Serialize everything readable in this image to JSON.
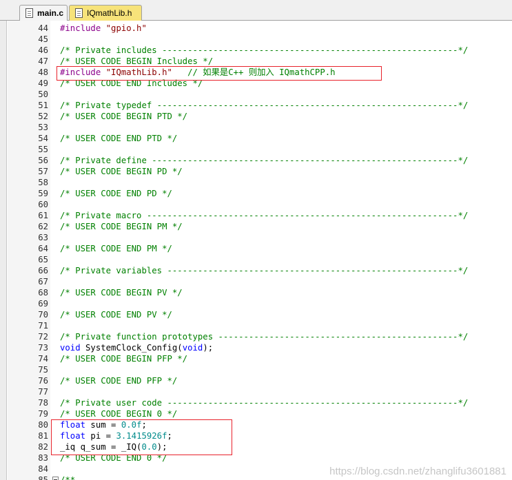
{
  "tabs": [
    {
      "label": "main.c",
      "active": false
    },
    {
      "label": "IQmathLib.h",
      "active": true
    }
  ],
  "lines": [
    {
      "n": "44",
      "segs": [
        {
          "t": "#include ",
          "c": "pp"
        },
        {
          "t": "\"gpio.h\"",
          "c": "str"
        }
      ]
    },
    {
      "n": "45",
      "segs": []
    },
    {
      "n": "46",
      "segs": [
        {
          "t": "/* Private includes ----------------------------------------------------------*/",
          "c": "cmt"
        }
      ]
    },
    {
      "n": "47",
      "segs": [
        {
          "t": "/* USER CODE BEGIN Includes */",
          "c": "cmt"
        }
      ]
    },
    {
      "n": "48",
      "segs": [
        {
          "t": "#include ",
          "c": "pp"
        },
        {
          "t": "\"IQmathLib.h\"",
          "c": "str"
        },
        {
          "t": "   // 如果是C++ 则加入 IQmathCPP.h",
          "c": "cmt"
        }
      ]
    },
    {
      "n": "49",
      "segs": [
        {
          "t": "/* USER CODE END Includes */",
          "c": "cmt"
        }
      ]
    },
    {
      "n": "50",
      "segs": []
    },
    {
      "n": "51",
      "segs": [
        {
          "t": "/* Private typedef -----------------------------------------------------------*/",
          "c": "cmt"
        }
      ]
    },
    {
      "n": "52",
      "segs": [
        {
          "t": "/* USER CODE BEGIN PTD */",
          "c": "cmt"
        }
      ]
    },
    {
      "n": "53",
      "segs": []
    },
    {
      "n": "54",
      "segs": [
        {
          "t": "/* USER CODE END PTD */",
          "c": "cmt"
        }
      ]
    },
    {
      "n": "55",
      "segs": []
    },
    {
      "n": "56",
      "segs": [
        {
          "t": "/* Private define ------------------------------------------------------------*/",
          "c": "cmt"
        }
      ]
    },
    {
      "n": "57",
      "segs": [
        {
          "t": "/* USER CODE BEGIN PD */",
          "c": "cmt"
        }
      ]
    },
    {
      "n": "58",
      "segs": []
    },
    {
      "n": "59",
      "segs": [
        {
          "t": "/* USER CODE END PD */",
          "c": "cmt"
        }
      ]
    },
    {
      "n": "60",
      "segs": []
    },
    {
      "n": "61",
      "segs": [
        {
          "t": "/* Private macro -------------------------------------------------------------*/",
          "c": "cmt"
        }
      ]
    },
    {
      "n": "62",
      "segs": [
        {
          "t": "/* USER CODE BEGIN PM */",
          "c": "cmt"
        }
      ]
    },
    {
      "n": "63",
      "segs": []
    },
    {
      "n": "64",
      "segs": [
        {
          "t": "/* USER CODE END PM */",
          "c": "cmt"
        }
      ]
    },
    {
      "n": "65",
      "segs": []
    },
    {
      "n": "66",
      "segs": [
        {
          "t": "/* Private variables ---------------------------------------------------------*/",
          "c": "cmt"
        }
      ]
    },
    {
      "n": "67",
      "segs": []
    },
    {
      "n": "68",
      "segs": [
        {
          "t": "/* USER CODE BEGIN PV */",
          "c": "cmt"
        }
      ]
    },
    {
      "n": "69",
      "segs": []
    },
    {
      "n": "70",
      "segs": [
        {
          "t": "/* USER CODE END PV */",
          "c": "cmt"
        }
      ]
    },
    {
      "n": "71",
      "segs": []
    },
    {
      "n": "72",
      "segs": [
        {
          "t": "/* Private function prototypes -----------------------------------------------*/",
          "c": "cmt"
        }
      ]
    },
    {
      "n": "73",
      "segs": [
        {
          "t": "void",
          "c": "kw"
        },
        {
          "t": " SystemClock_Config(",
          "c": "plain"
        },
        {
          "t": "void",
          "c": "kw"
        },
        {
          "t": ");",
          "c": "plain"
        }
      ]
    },
    {
      "n": "74",
      "segs": [
        {
          "t": "/* USER CODE BEGIN PFP */",
          "c": "cmt"
        }
      ]
    },
    {
      "n": "75",
      "segs": []
    },
    {
      "n": "76",
      "segs": [
        {
          "t": "/* USER CODE END PFP */",
          "c": "cmt"
        }
      ]
    },
    {
      "n": "77",
      "segs": []
    },
    {
      "n": "78",
      "segs": [
        {
          "t": "/* Private user code ---------------------------------------------------------*/",
          "c": "cmt"
        }
      ]
    },
    {
      "n": "79",
      "segs": [
        {
          "t": "/* USER CODE BEGIN 0 */",
          "c": "cmt"
        }
      ]
    },
    {
      "n": "80",
      "segs": [
        {
          "t": "float",
          "c": "kw"
        },
        {
          "t": " sum = ",
          "c": "plain"
        },
        {
          "t": "0.0f",
          "c": "num"
        },
        {
          "t": ";",
          "c": "plain"
        }
      ]
    },
    {
      "n": "81",
      "segs": [
        {
          "t": "float",
          "c": "kw"
        },
        {
          "t": " pi = ",
          "c": "plain"
        },
        {
          "t": "3.1415926f",
          "c": "num"
        },
        {
          "t": ";",
          "c": "plain"
        }
      ]
    },
    {
      "n": "82",
      "segs": [
        {
          "t": "_iq q_sum = _IQ(",
          "c": "plain"
        },
        {
          "t": "0.0",
          "c": "num"
        },
        {
          "t": ");",
          "c": "plain"
        }
      ]
    },
    {
      "n": "83",
      "segs": [
        {
          "t": "/* USER CODE END 0 */",
          "c": "cmt"
        }
      ]
    },
    {
      "n": "84",
      "segs": []
    },
    {
      "n": "85",
      "segs": [
        {
          "t": "/**",
          "c": "cmt"
        }
      ],
      "fold": true
    }
  ],
  "watermark": "https://blog.csdn.net/zhanglifu3601881",
  "colors": {
    "comment": "#008000",
    "preprocessor": "#8b008b",
    "string": "#8b0000",
    "keyword": "#0000ff",
    "number": "#008b8b",
    "highlight_box": "#e8212a",
    "active_tab": "#f7e37a"
  }
}
